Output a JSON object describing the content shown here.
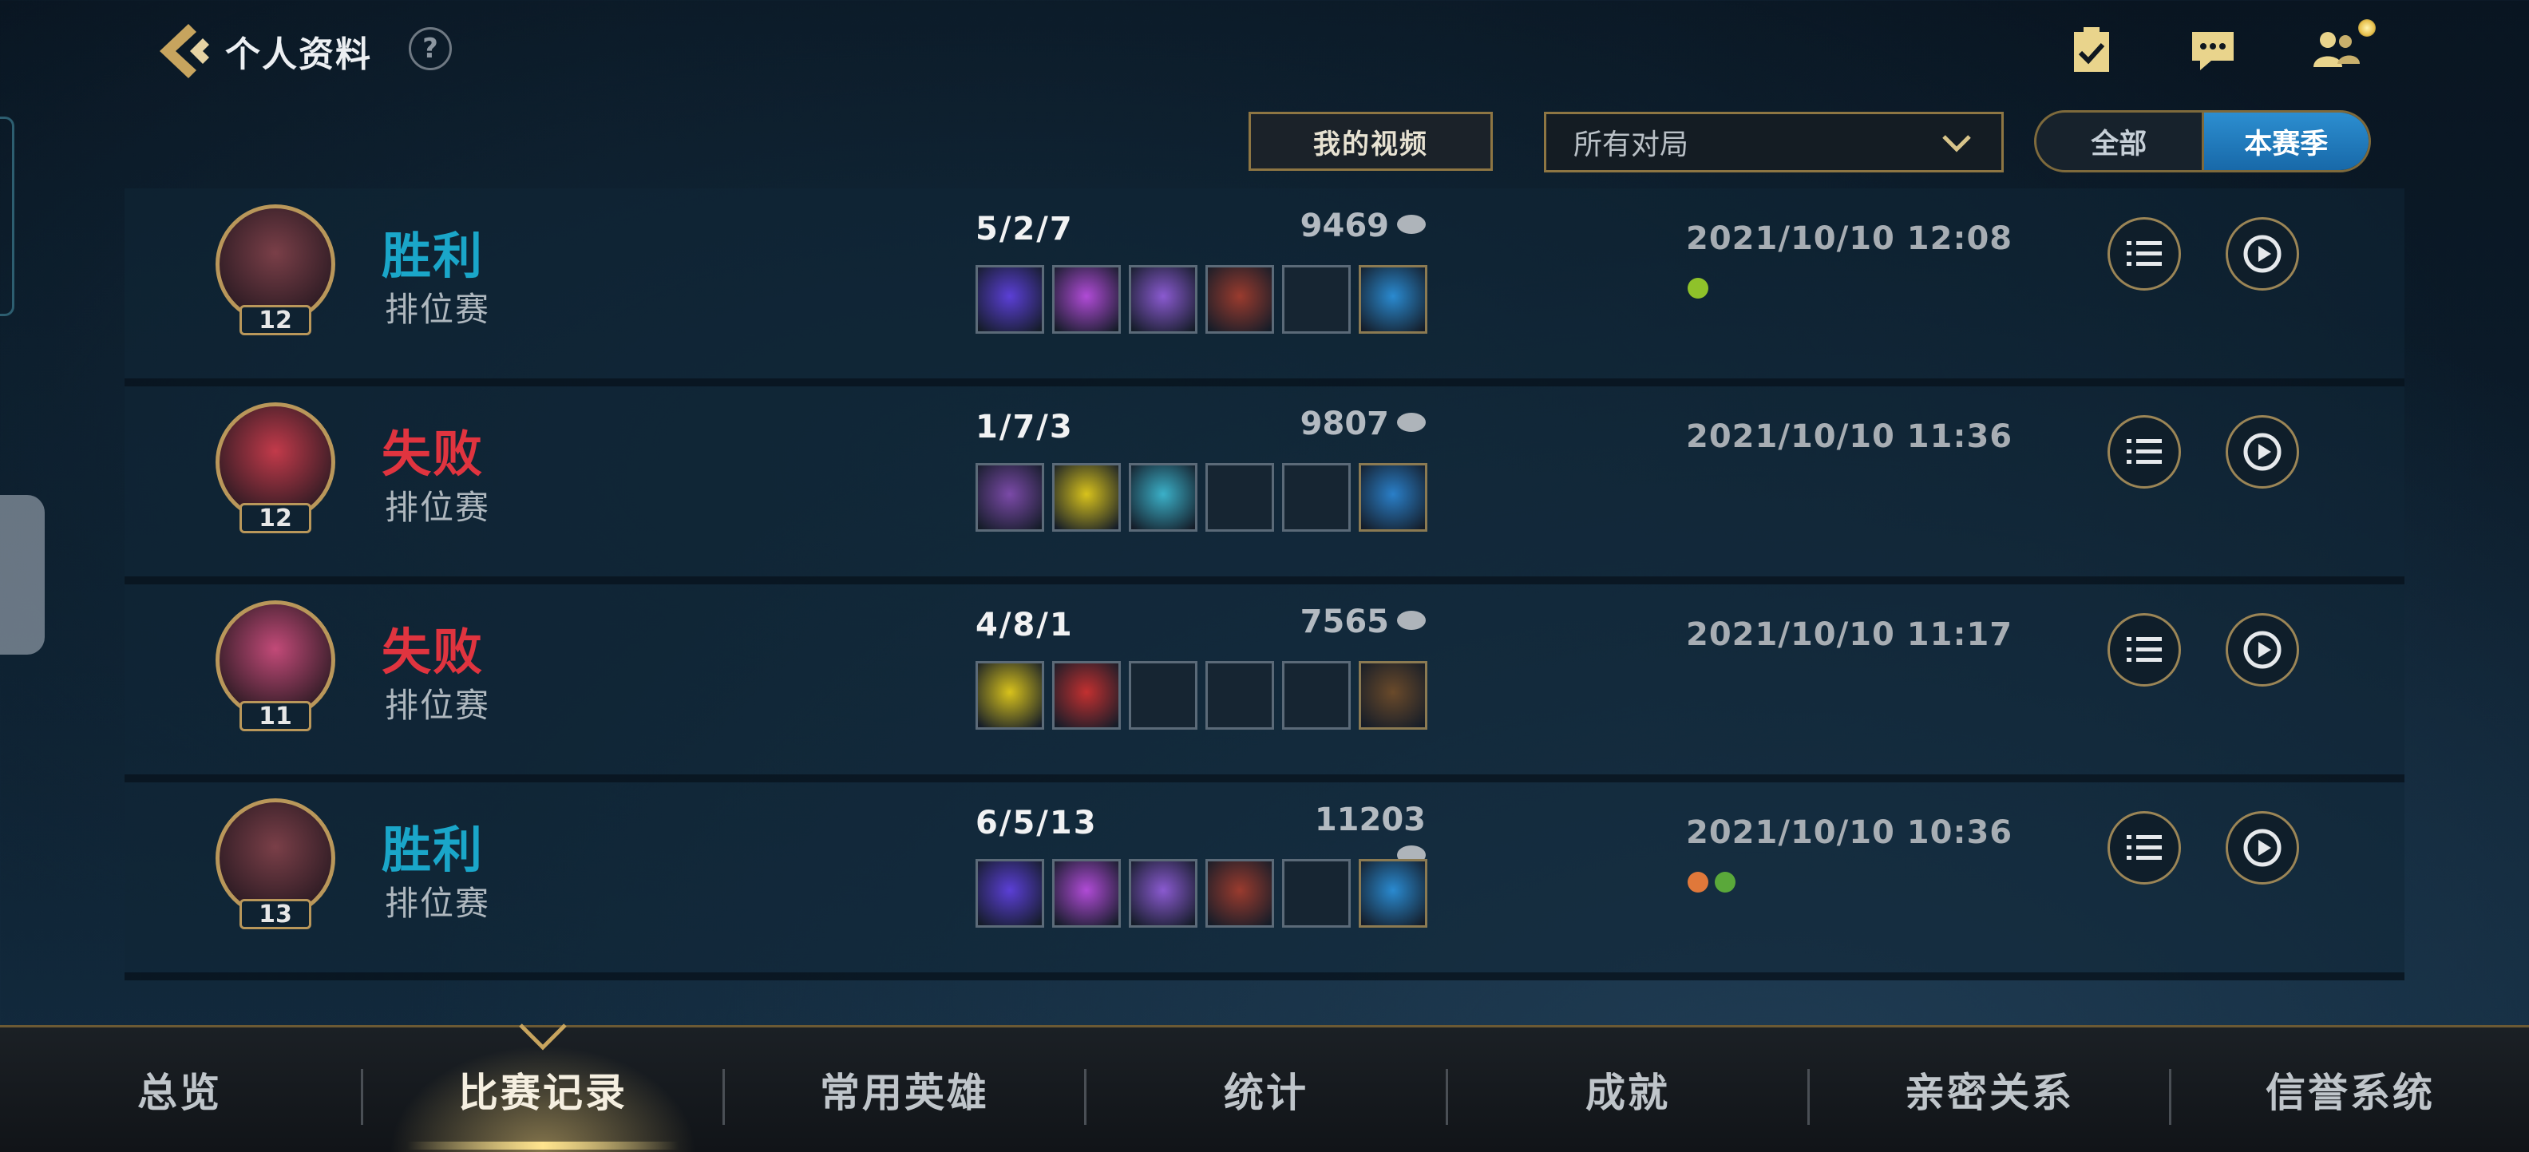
{
  "header": {
    "title": "个人资料",
    "help_label": "?",
    "icons": [
      "back-chevron-icon",
      "help-icon",
      "task-checklist-icon",
      "chat-icon",
      "friends-icon"
    ]
  },
  "filters": {
    "video_button": "我的视频",
    "match_filter": "所有对局",
    "season_toggle": {
      "all": "全部",
      "season": "本赛季",
      "active": "本赛季"
    }
  },
  "matches": [
    {
      "result": "胜利",
      "result_type": "win",
      "mode": "排位赛",
      "level": "12",
      "kda": "5/2/7",
      "gold": "9469",
      "time": "2021/10/10 12:08",
      "avatar_color": "#7a3f48",
      "items": [
        "#5b3fd6",
        "#b04bd6",
        "#8a5ad0",
        "#9a3b2e",
        "",
        "#2a8ad0"
      ],
      "badges": [
        "#8fc22a"
      ]
    },
    {
      "result": "失败",
      "result_type": "loss",
      "mode": "排位赛",
      "level": "12",
      "kda": "1/7/3",
      "gold": "9807",
      "time": "2021/10/10 11:36",
      "avatar_color": "#c23a4a",
      "items": [
        "#7b4aa8",
        "#d8c21c",
        "#3bb0c8",
        "",
        "",
        "#2a7fc8"
      ],
      "badges": []
    },
    {
      "result": "失败",
      "result_type": "loss",
      "mode": "排位赛",
      "level": "11",
      "kda": "4/8/1",
      "gold": "7565",
      "time": "2021/10/10 11:17",
      "avatar_color": "#c24a78",
      "items": [
        "#d8c21c",
        "#c23030",
        "",
        "",
        "",
        "#6a4a2a"
      ],
      "badges": []
    },
    {
      "result": "胜利",
      "result_type": "win",
      "mode": "排位赛",
      "level": "13",
      "kda": "6/5/13",
      "gold": "11203",
      "time": "2021/10/10 10:36",
      "avatar_color": "#7a3f48",
      "items": [
        "#5b3fd6",
        "#b04bd6",
        "#8a5ad0",
        "#9a3b2e",
        "",
        "#2a8ad0"
      ],
      "badges": [
        "#e0783a",
        "#5aa83a"
      ]
    }
  ],
  "nav": {
    "items": [
      "总览",
      "比赛记录",
      "常用英雄",
      "统计",
      "成就",
      "亲密关系",
      "信誉系统"
    ],
    "active": "比赛记录"
  },
  "colors": {
    "win": "#1aa6c9",
    "loss": "#e0343f",
    "gold_border": "#b9975a",
    "accent_blue": "#1f7cc0"
  }
}
